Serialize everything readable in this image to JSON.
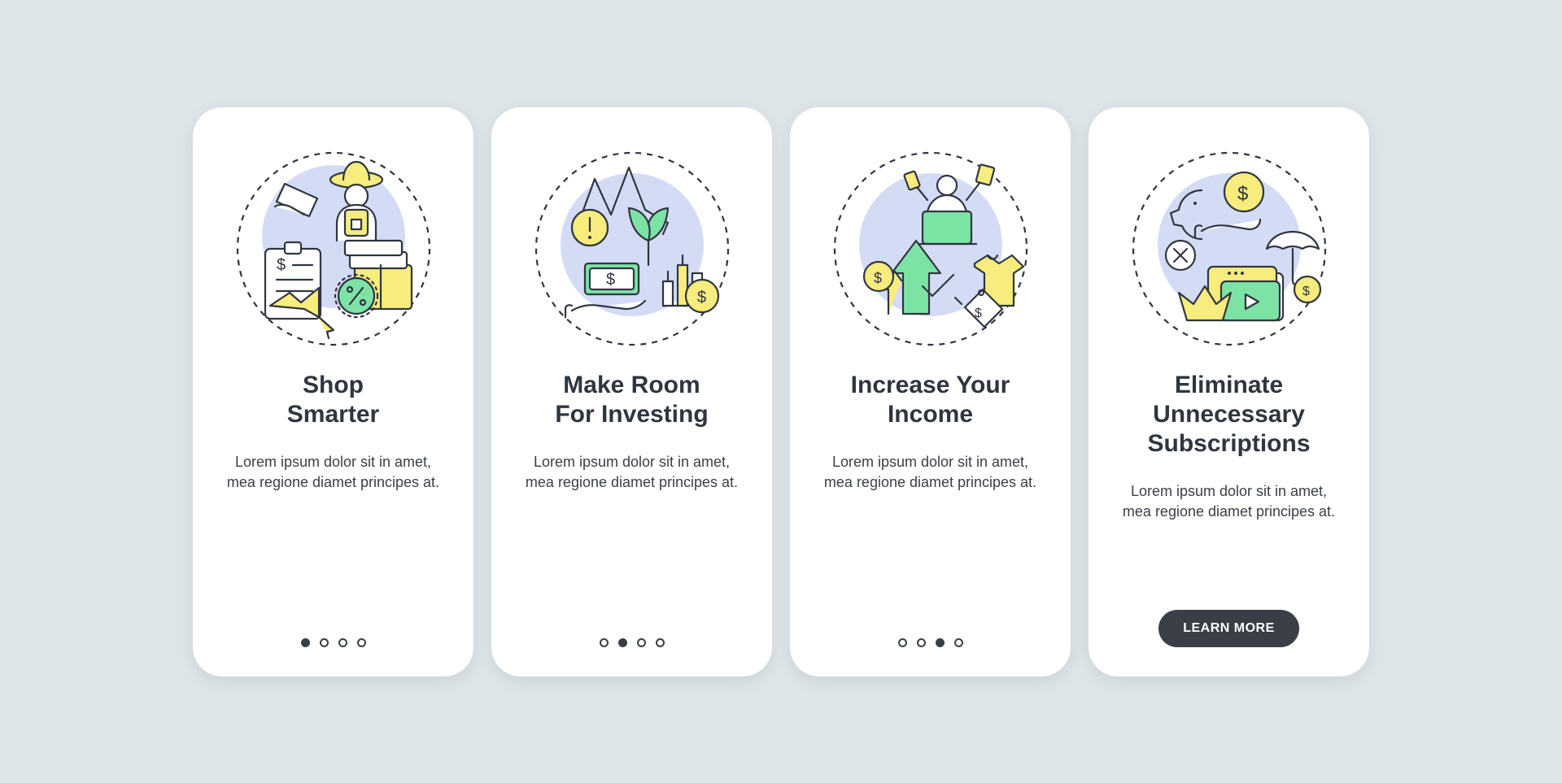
{
  "cards": [
    {
      "title": "Shop\nSmarter",
      "body": "Lorem ipsum dolor sit in amet, mea regione diamet principes at.",
      "iconName": "shop-smarter-illustration"
    },
    {
      "title": "Make Room\nFor Investing",
      "body": "Lorem ipsum dolor sit in amet, mea regione diamet principes at.",
      "iconName": "investing-illustration"
    },
    {
      "title": "Increase Your\nIncome",
      "body": "Lorem ipsum dolor sit in amet, mea regione diamet principes at.",
      "iconName": "increase-income-illustration"
    },
    {
      "title": "Eliminate\nUnnecessary\nSubscriptions",
      "body": "Lorem ipsum dolor sit in amet, mea regione diamet principes at.",
      "iconName": "eliminate-subscriptions-illustration"
    }
  ],
  "pagerDotsTotal": 4,
  "ctaLabel": "LEARN MORE",
  "colors": {
    "background": "#DDE5E9",
    "card": "#FFFFFF",
    "text": "#2F3640",
    "accentYellow": "#F7EC7E",
    "accentGreen": "#7CE3A5",
    "accentBlue": "#D4DBF5",
    "ctaBg": "#3A3F47"
  }
}
